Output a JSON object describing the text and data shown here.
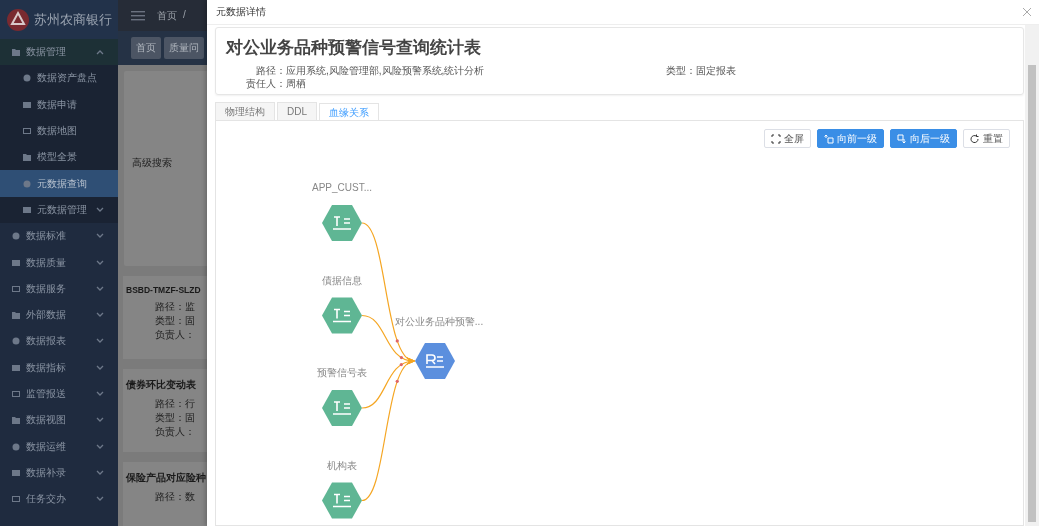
{
  "sidebar": {
    "logo": "苏州农商银行",
    "menu": [
      {
        "label": "数据管理",
        "expanded": true,
        "children": [
          {
            "label": "数据资产盘点",
            "kind": "page",
            "selected": false
          },
          {
            "label": "数据申请",
            "kind": "page",
            "selected": false
          },
          {
            "label": "数据地图",
            "kind": "page",
            "selected": false
          },
          {
            "label": "模型全景",
            "kind": "page",
            "selected": false
          },
          {
            "label": "元数据查询",
            "kind": "page",
            "selected": true
          },
          {
            "label": "元数据管理",
            "kind": "group",
            "selected": false,
            "expanded": false
          }
        ]
      },
      {
        "label": "数据标准",
        "expanded": false
      },
      {
        "label": "数据质量",
        "expanded": false
      },
      {
        "label": "数据服务",
        "expanded": false
      },
      {
        "label": "外部数据",
        "expanded": false
      },
      {
        "label": "数据报表",
        "expanded": false
      },
      {
        "label": "数据指标",
        "expanded": false
      },
      {
        "label": "监管报送",
        "expanded": false
      },
      {
        "label": "数据视图",
        "expanded": false
      },
      {
        "label": "数据运维",
        "expanded": false
      },
      {
        "label": "数据补录",
        "expanded": false
      },
      {
        "label": "任务交办",
        "expanded": false
      }
    ]
  },
  "breadcrumb": [
    "首页",
    "/"
  ],
  "page_tags": [
    "首页",
    "质量问"
  ],
  "search_panel": {
    "title": "高级搜索"
  },
  "result_cards": [
    {
      "title": "BSBD-TMZF-SLZD",
      "fields": [
        "路径：监",
        "类型：固",
        "负责人："
      ]
    },
    {
      "title": "债券环比变动表",
      "fields": [
        "路径：行",
        "类型：固",
        "负责人："
      ]
    },
    {
      "title": "保险产品对应险种",
      "fields": [
        "路径：数"
      ]
    }
  ],
  "modal": {
    "title": "元数据详情",
    "header": {
      "title": "对公业务品种预警信号查询统计表",
      "path": "路径：应用系统,风险管理部,风险预警系统,统计分析",
      "type": "类型：固定报表",
      "owner": "责任人：周栖"
    },
    "tabs": [
      {
        "label": "物理结构",
        "selected": false
      },
      {
        "label": "DDL",
        "selected": false
      },
      {
        "label": "血缘关系",
        "selected": true
      }
    ],
    "toolbar": [
      {
        "label": "全屏",
        "kind": "plain"
      },
      {
        "label": "向前一级",
        "kind": "primary"
      },
      {
        "label": "向后一级",
        "kind": "primary"
      },
      {
        "label": "重置",
        "kind": "plain"
      }
    ],
    "graph": {
      "nodes": [
        {
          "label": "APP_CUST...",
          "kind": "table"
        },
        {
          "label": "債据信息",
          "kind": "table"
        },
        {
          "label": "预警信号表",
          "kind": "table"
        },
        {
          "label": "机构表",
          "kind": "table"
        },
        {
          "label": "对公业务品种预警...",
          "kind": "report"
        }
      ]
    }
  }
}
